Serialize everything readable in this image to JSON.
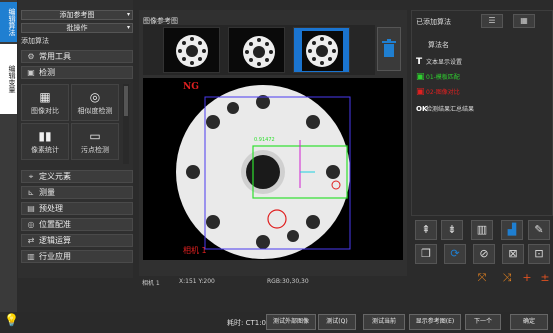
{
  "tabs": {
    "edit_algo": "编辑算法",
    "edit_var": "编辑变量"
  },
  "left": {
    "add_ref_dropdown": "添加参考图",
    "batch_dropdown": "批操作",
    "add_algo_label": "添加算法",
    "categories": [
      {
        "label": "常用工具",
        "icon": "gear-icon"
      },
      {
        "label": "检测",
        "icon": "camera-icon"
      },
      {
        "label": "定义元素",
        "icon": "element-icon"
      },
      {
        "label": "测量",
        "icon": "ruler-icon"
      },
      {
        "label": "预处理",
        "icon": "filter-icon"
      },
      {
        "label": "位置配准",
        "icon": "target-icon"
      },
      {
        "label": "逻辑运算",
        "icon": "logic-icon"
      },
      {
        "label": "行业应用",
        "icon": "industry-icon"
      }
    ],
    "tiles": [
      {
        "label": "图像对比",
        "icon": "image-compare-icon"
      },
      {
        "label": "相似度检测",
        "icon": "similarity-icon"
      },
      {
        "label": "像素统计",
        "icon": "bar-chart-icon"
      },
      {
        "label": "污点检测",
        "icon": "stain-icon"
      }
    ]
  },
  "middle": {
    "ref_label": "图像参考图",
    "overlay": {
      "ng": "NG",
      "camera": "相机 1",
      "match_text": "0.91472"
    },
    "status": {
      "camera": "相机 1",
      "coords": "X:151 Y:200",
      "rgb": "RGB:30,30,30"
    }
  },
  "right": {
    "title": "已添加算法",
    "alg_header": "算法名",
    "algorithms": [
      {
        "icon": "T",
        "label": "文本显示设置",
        "color": "#dddddd"
      },
      {
        "icon": "▣",
        "label": "01-模板匹配",
        "color": "#2fd02f"
      },
      {
        "icon": "▣",
        "label": "02-图像对比",
        "color": "#e02020"
      },
      {
        "icon": "OK",
        "label": "检测结果汇总结果",
        "color": "#dddddd"
      }
    ]
  },
  "bottom": {
    "time": "耗时: CT1:0.015s;",
    "buttons": [
      "测试外部图像",
      "测试(Q)",
      "测试当前",
      "显示参考图(E)",
      "下一个",
      "确定"
    ]
  }
}
